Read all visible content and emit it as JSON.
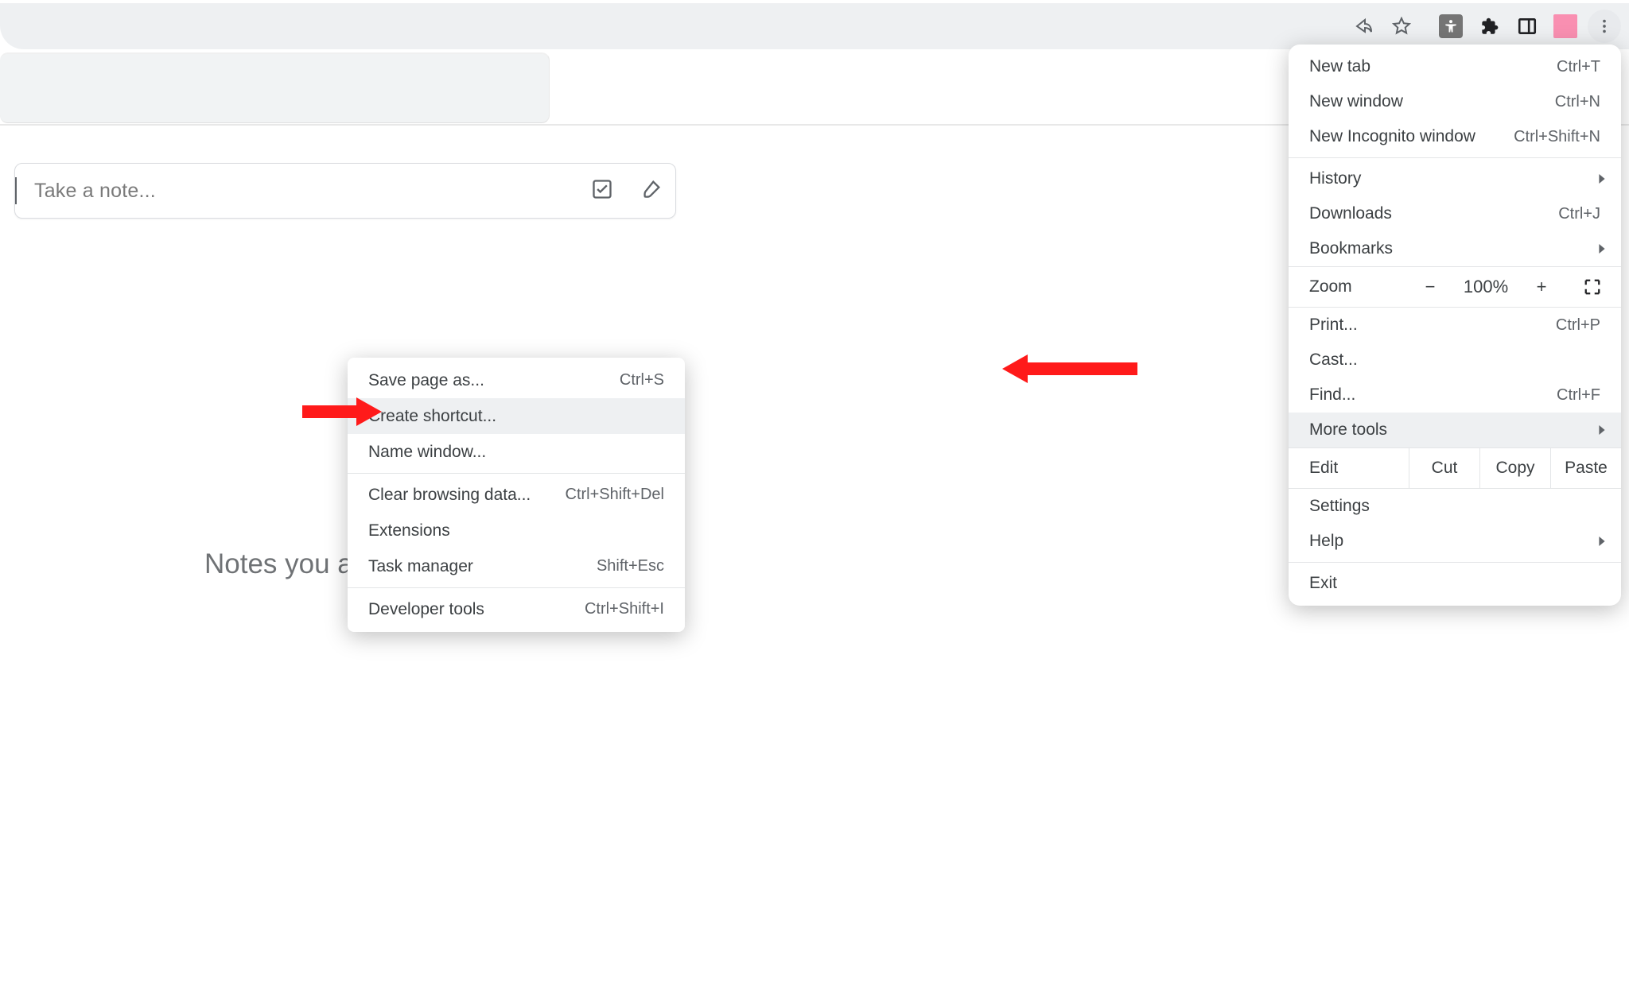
{
  "toolbar": {
    "icons": [
      "share-icon",
      "star-icon",
      "accessibility-icon",
      "extensions-icon",
      "sidepanel-icon",
      "profile-icon",
      "kebab-menu-icon"
    ]
  },
  "note_input": {
    "placeholder": "Take a note...",
    "tools": [
      "checkbox-icon",
      "brush-icon"
    ]
  },
  "empty_state_text": "Notes you a",
  "main_menu": {
    "items": [
      {
        "label": "New tab",
        "shortcut": "Ctrl+T"
      },
      {
        "label": "New window",
        "shortcut": "Ctrl+N"
      },
      {
        "label": "New Incognito window",
        "shortcut": "Ctrl+Shift+N"
      }
    ],
    "items2": [
      {
        "label": "History",
        "submenu": true
      },
      {
        "label": "Downloads",
        "shortcut": "Ctrl+J"
      },
      {
        "label": "Bookmarks",
        "submenu": true
      }
    ],
    "zoom": {
      "label": "Zoom",
      "minus": "−",
      "value": "100%",
      "plus": "+"
    },
    "items3": [
      {
        "label": "Print...",
        "shortcut": "Ctrl+P"
      },
      {
        "label": "Cast..."
      },
      {
        "label": "Find...",
        "shortcut": "Ctrl+F"
      },
      {
        "label": "More tools",
        "submenu": true,
        "highlight": true
      }
    ],
    "edit": {
      "label": "Edit",
      "cut": "Cut",
      "copy": "Copy",
      "paste": "Paste"
    },
    "items4": [
      {
        "label": "Settings"
      },
      {
        "label": "Help",
        "submenu": true
      }
    ],
    "items5": [
      {
        "label": "Exit"
      }
    ]
  },
  "sub_menu": {
    "items1": [
      {
        "label": "Save page as...",
        "shortcut": "Ctrl+S"
      },
      {
        "label": "Create shortcut...",
        "highlight": true
      },
      {
        "label": "Name window..."
      }
    ],
    "items2": [
      {
        "label": "Clear browsing data...",
        "shortcut": "Ctrl+Shift+Del"
      },
      {
        "label": "Extensions"
      },
      {
        "label": "Task manager",
        "shortcut": "Shift+Esc"
      }
    ],
    "items3": [
      {
        "label": "Developer tools",
        "shortcut": "Ctrl+Shift+I"
      }
    ]
  }
}
